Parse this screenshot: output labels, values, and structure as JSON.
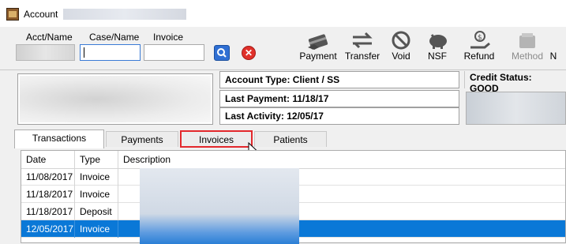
{
  "window": {
    "title": "Account"
  },
  "search": {
    "acct_label": "Acct/Name",
    "case_label": "Case/Name",
    "invoice_label": "Invoice",
    "acct_value": "",
    "case_value": "",
    "invoice_value": ""
  },
  "toolbar": [
    {
      "label": "Payment",
      "icon": "payment-card-icon",
      "enabled": true
    },
    {
      "label": "Transfer",
      "icon": "transfer-arrows-icon",
      "enabled": true
    },
    {
      "label": "Void",
      "icon": "void-circle-icon",
      "enabled": true
    },
    {
      "label": "NSF",
      "icon": "piggy-bank-icon",
      "enabled": true
    },
    {
      "label": "Refund",
      "icon": "refund-hand-icon",
      "enabled": true
    },
    {
      "label": "Method",
      "icon": "wallet-icon",
      "enabled": false
    },
    {
      "label": "N",
      "icon": "",
      "enabled": true
    }
  ],
  "account": {
    "type_text": "Account Type: Client / SS",
    "last_payment_text": "Last Payment: 11/18/17",
    "last_activity_text": "Last Activity: 12/05/17",
    "credit_status_text": "Credit Status: GOOD"
  },
  "tabs": [
    {
      "label": "Transactions",
      "active": true
    },
    {
      "label": "Payments",
      "active": false
    },
    {
      "label": "Invoices",
      "active": false,
      "highlighted": true
    },
    {
      "label": "Patients",
      "active": false
    }
  ],
  "grid": {
    "columns": [
      "Date",
      "Type",
      "Description"
    ],
    "rows": [
      {
        "date": "11/08/2017",
        "type": "Invoice",
        "selected": false
      },
      {
        "date": "11/18/2017",
        "type": "Invoice",
        "selected": false
      },
      {
        "date": "11/18/2017",
        "type": "Deposit",
        "selected": false
      },
      {
        "date": "12/05/2017",
        "type": "Invoice",
        "selected": true
      }
    ]
  },
  "colors": {
    "selection": "#0a78d7",
    "highlight": "#e3282c",
    "accent": "#2f6fd3"
  }
}
